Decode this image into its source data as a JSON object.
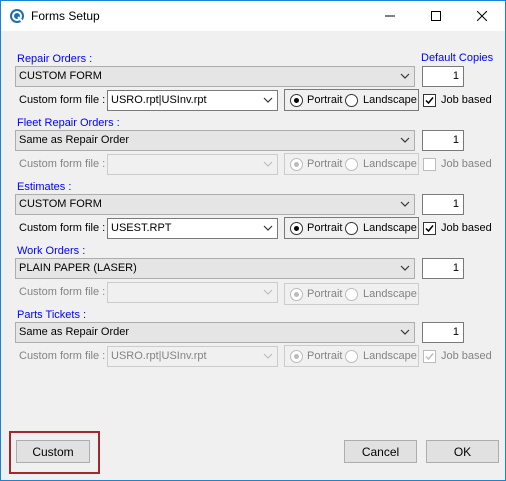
{
  "window": {
    "title": "Forms Setup",
    "minimize_glyph": "minimize-icon",
    "maximize_glyph": "maximize-icon",
    "close_glyph": "close-icon"
  },
  "header": {
    "default_copies_label": "Default Copies"
  },
  "common": {
    "custom_form_file_label": "Custom form file :",
    "portrait_label": "Portrait",
    "landscape_label": "Landscape",
    "job_based_label": "Job based"
  },
  "sections": [
    {
      "label": "Repair Orders :",
      "form_value": "CUSTOM FORM",
      "copies": "1",
      "custom_file": "USRO.rpt|USInv.rpt",
      "orientation": "Portrait",
      "job_based": true,
      "enabled": true
    },
    {
      "label": "Fleet Repair Orders :",
      "form_value": "Same as Repair Order",
      "copies": "1",
      "custom_file": "",
      "orientation": "Portrait",
      "job_based": false,
      "enabled": false
    },
    {
      "label": "Estimates :",
      "form_value": "CUSTOM FORM",
      "copies": "1",
      "custom_file": "USEST.RPT",
      "orientation": "Portrait",
      "job_based": true,
      "enabled": true
    },
    {
      "label": "Work Orders :",
      "form_value": "PLAIN PAPER (LASER)",
      "copies": "1",
      "custom_file": "",
      "orientation": "Portrait",
      "job_based": null,
      "enabled": false
    },
    {
      "label": "Parts Tickets :",
      "form_value": "Same as Repair Order",
      "copies": "1",
      "custom_file": "USRO.rpt|USInv.rpt",
      "orientation": "Portrait",
      "job_based": true,
      "enabled": false
    }
  ],
  "footer": {
    "custom_button": "Custom",
    "cancel_button": "Cancel",
    "ok_button": "OK"
  },
  "colors": {
    "accent": "#0000ff",
    "highlight": "#a0282e",
    "title_border": "#1883d7"
  }
}
